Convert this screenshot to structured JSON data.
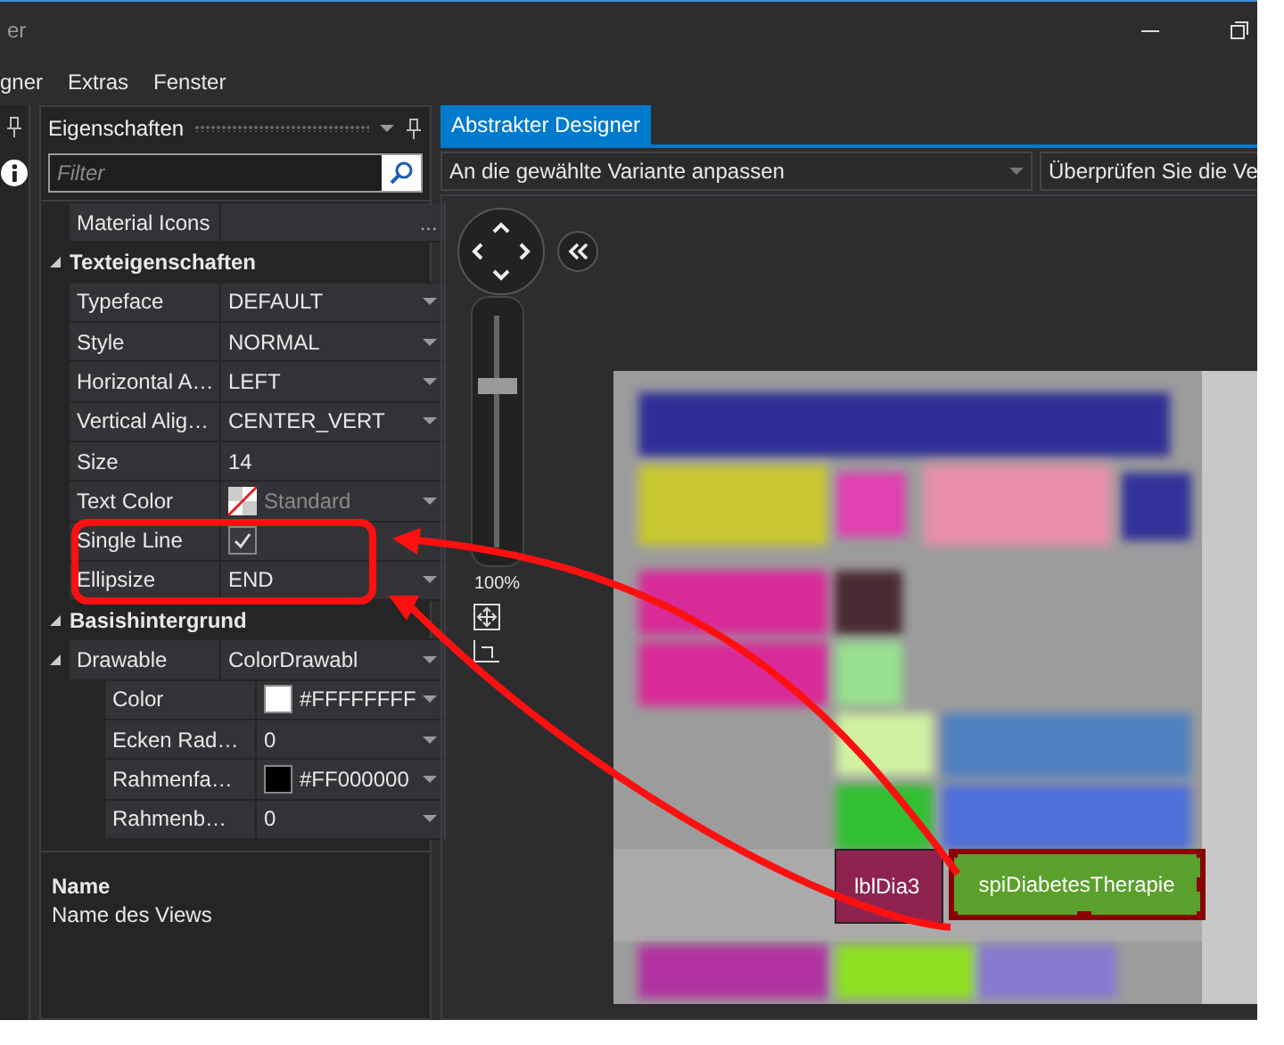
{
  "window": {
    "title": "er"
  },
  "menu": [
    "gner",
    "Extras",
    "Fenster"
  ],
  "properties_panel": {
    "title": "Eigenschaften",
    "filter": {
      "placeholder": "Filter"
    },
    "rows": [
      {
        "kind": "button_property",
        "label": "Material Icons",
        "button": "..."
      },
      {
        "kind": "category",
        "label": "Texteigenschaften",
        "expanded": true,
        "children": [
          {
            "kind": "property",
            "label": "Typeface",
            "value": "DEFAULT",
            "dropdown": true
          },
          {
            "kind": "property",
            "label": "Style",
            "value": "NORMAL",
            "dropdown": true
          },
          {
            "kind": "property",
            "label": "Horizontal A…",
            "value": "LEFT",
            "dropdown": true
          },
          {
            "kind": "property",
            "label": "Vertical Alig…",
            "value": "CENTER_VERT",
            "dropdown": true
          },
          {
            "kind": "property",
            "label": "Size",
            "value": "14",
            "dropdown": false
          },
          {
            "kind": "color",
            "label": "Text Color",
            "value": "Standard",
            "is_default": true,
            "dropdown": true
          },
          {
            "kind": "checkbox",
            "label": "Single Line",
            "checked": true
          },
          {
            "kind": "property",
            "label": "Ellipsize",
            "value": "END",
            "dropdown": true
          }
        ]
      },
      {
        "kind": "category",
        "label": "Basishintergrund",
        "expanded": true,
        "children": [
          {
            "kind": "property",
            "label": "Drawable",
            "value": "ColorDrawabl",
            "dropdown": true,
            "expanded": true,
            "children": [
              {
                "kind": "color",
                "label": "Color",
                "color": "#ffffff",
                "value": "#FFFFFFFF",
                "is_default": false,
                "dropdown": true
              },
              {
                "kind": "property",
                "label": "Ecken Rad…",
                "value": "0",
                "dropdown": true
              },
              {
                "kind": "color",
                "label": "Rahmenfa…",
                "color": "#000000",
                "value": "#FF000000",
                "is_default": false,
                "dropdown": true
              },
              {
                "kind": "property",
                "label": "Rahmenb…",
                "value": "0",
                "dropdown": true
              }
            ]
          }
        ]
      }
    ],
    "description": {
      "name": "Name",
      "text": "Name des Views"
    }
  },
  "designer": {
    "tabs": [
      {
        "label": "Abstrakter Designer",
        "selected": true
      }
    ],
    "variant_select": {
      "value": "An die gewählte Variante anpassen"
    },
    "check_select": {
      "value": "Überprüfen Sie die Ve"
    },
    "zoom": {
      "level": 0.7,
      "reading": "100%"
    },
    "widgets": [
      {
        "label": "lblDia3",
        "color": "#8e2350",
        "selected": false
      },
      {
        "label": "spiDiabetesTherapie",
        "color": "#5aa02c",
        "selected": true
      }
    ]
  }
}
